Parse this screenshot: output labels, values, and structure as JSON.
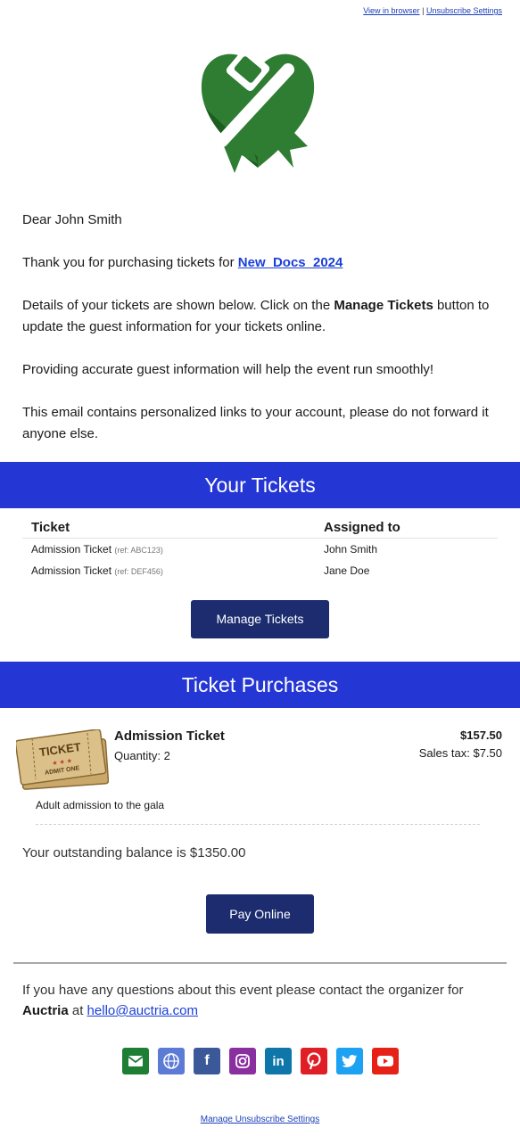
{
  "header": {
    "view_in_browser": "View in browser",
    "separator": "|",
    "unsubscribe_settings": "Unsubscribe Settings"
  },
  "logo": {
    "icon": "green-heart-ribbon-logo",
    "color": "#2e7d32"
  },
  "intro": {
    "greeting": "Dear John Smith",
    "thank_you_prefix": "Thank you for purchasing tickets for ",
    "event_link": "New_Docs_2024",
    "details_prefix": "Details of your tickets are shown below.  Click on the ",
    "details_bold": "Manage Tickets",
    "details_suffix": " button to update the guest information for your tickets online.",
    "accuracy": "Providing accurate guest information will help the event run smoothly!",
    "personalized": "This email contains personalized links to your account, please do not forward it anyone else."
  },
  "your_tickets": {
    "title": "Your Tickets",
    "col_ticket": "Ticket",
    "col_assigned": "Assigned to",
    "rows": [
      {
        "ticket": "Admission Ticket",
        "ref": "(ref: ABC123)",
        "assigned": "John Smith"
      },
      {
        "ticket": "Admission Ticket",
        "ref": "(ref: DEF456)",
        "assigned": "Jane Doe"
      }
    ],
    "manage_button": "Manage Tickets"
  },
  "purchases": {
    "title": "Ticket Purchases",
    "item_name": "Admission Ticket",
    "quantity": "Quantity: 2",
    "price": "$157.50",
    "sales_tax": "Sales tax: $7.50",
    "description": "Adult admission to the gala",
    "ticket_image_text": "TICKET",
    "ticket_image_sub": "ADMIT ONE",
    "balance": "Your outstanding balance is $1350.00",
    "pay_button": "Pay Online"
  },
  "contact": {
    "prefix": "If you have any questions about this event please contact the organizer for ",
    "org": "Auctria",
    "at": " at ",
    "email": "hello@auctria.com"
  },
  "social": [
    {
      "name": "email-icon",
      "color": "#1e7e34",
      "glyph": "✉"
    },
    {
      "name": "website-icon",
      "color": "#5b7bd5",
      "glyph": "◍"
    },
    {
      "name": "facebook-icon",
      "color": "#3b5998",
      "glyph": "f"
    },
    {
      "name": "instagram-icon",
      "color": "#8a2fa0",
      "glyph": "◎"
    },
    {
      "name": "linkedin-icon",
      "color": "#0e76a8",
      "glyph": "in"
    },
    {
      "name": "pinterest-icon",
      "color": "#e01e26",
      "glyph": "P"
    },
    {
      "name": "twitter-icon",
      "color": "#1da1f2",
      "glyph": "t"
    },
    {
      "name": "youtube-icon",
      "color": "#e62117",
      "glyph": "▶"
    }
  ],
  "footer": {
    "manage_unsubscribe": "Manage Unsubscribe Settings"
  },
  "colors": {
    "band": "#2436d4",
    "button": "#1c2c6f",
    "link": "#1a3fd8"
  }
}
